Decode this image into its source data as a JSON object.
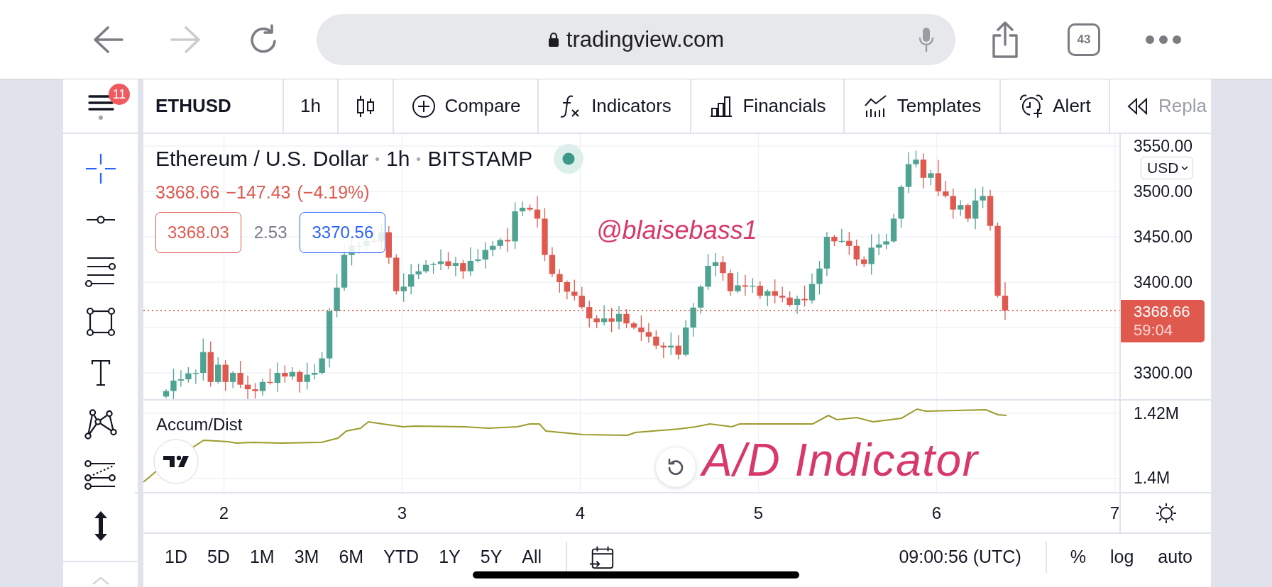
{
  "browser": {
    "nav_buttons": [
      {
        "kind": "back",
        "disabled": false
      },
      {
        "kind": "forward",
        "disabled": true
      },
      {
        "kind": "reload",
        "disabled": false
      }
    ],
    "address": "tradingview.com",
    "tab_count": "43"
  },
  "menu": {
    "badge": "11"
  },
  "drawing_tools": [
    {
      "kind": "crosshair",
      "selected": true
    },
    {
      "kind": "trend_line",
      "selected": false
    },
    {
      "kind": "fib_lines",
      "selected": false
    },
    {
      "kind": "rectangle",
      "selected": false
    },
    {
      "kind": "text",
      "selected": false
    },
    {
      "kind": "pattern",
      "selected": false
    },
    {
      "kind": "projection",
      "selected": false
    },
    {
      "kind": "measure",
      "selected": false
    }
  ],
  "toolbar": [
    {
      "kind": "symbol",
      "label": "ETHUSD"
    },
    {
      "kind": "interval",
      "label": "1h"
    },
    {
      "kind": "chart_type"
    },
    {
      "kind": "compare",
      "label": "Compare"
    },
    {
      "kind": "indicators",
      "label": "Indicators"
    },
    {
      "kind": "financials",
      "label": "Financials"
    },
    {
      "kind": "templates",
      "label": "Templates"
    },
    {
      "kind": "alert",
      "label": "Alert"
    },
    {
      "kind": "replay",
      "label": "Repla"
    }
  ],
  "chart": {
    "legend": {
      "name": "Ethereum / U.S. Dollar",
      "interval": "1h",
      "exchange": "BITSTAMP",
      "market_open": true,
      "last": "3368.66",
      "change": "−147.43",
      "change_percent": "(−4.19%)",
      "negative": true,
      "sell": "3368.03",
      "spread": "2.53",
      "buy": "3370.56"
    },
    "handle_annotation": "@blaisebass1",
    "currency": "USD",
    "price_axis": [
      {
        "kind": "tick",
        "text": "3550.00"
      },
      {
        "kind": "tick",
        "text": "3500.00"
      },
      {
        "kind": "tick",
        "text": "3450.00"
      },
      {
        "kind": "tick",
        "text": "3400.00"
      },
      {
        "kind": "tag",
        "price": "3368.66",
        "countdown": "59:04"
      },
      {
        "kind": "tick",
        "text": "3300.00"
      }
    ],
    "indicator": {
      "name": "Accum/Dist",
      "caption_annotation": "A/D Indicator",
      "axis": [
        "1.42M",
        "1.4M"
      ]
    },
    "time_axis": [
      "2",
      "3",
      "4",
      "5",
      "6",
      "7"
    ]
  },
  "bottom_bar": {
    "ranges": [
      "1D",
      "5D",
      "1M",
      "3M",
      "6M",
      "YTD",
      "1Y",
      "5Y",
      "All"
    ],
    "clock": "09:00:56 (UTC)",
    "scale_options": [
      "%",
      "log",
      "auto"
    ]
  }
}
